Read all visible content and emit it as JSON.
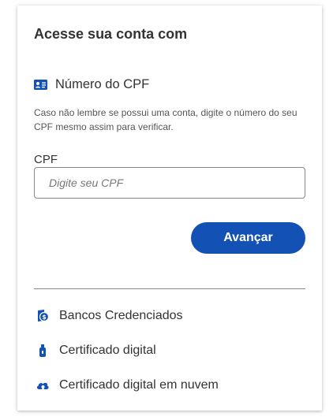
{
  "card": {
    "title": "Acesse sua conta com"
  },
  "cpf_section": {
    "icon": "id-card-icon",
    "heading": "Número do CPF",
    "hint": "Caso não lembre se possui uma conta, digite o número do seu CPF mesmo assim para verificar.",
    "field_label": "CPF",
    "input_value": "",
    "input_placeholder": "Digite seu CPF",
    "submit_label": "Avançar"
  },
  "other_options": [
    {
      "icon": "bank-icon",
      "label": "Bancos Credenciados"
    },
    {
      "icon": "usb-token-icon",
      "label": "Certificado digital"
    },
    {
      "icon": "cloud-certificate-icon",
      "label": "Certificado digital em nuvem"
    }
  ],
  "colors": {
    "primary": "#1351b4",
    "text": "#333333",
    "border": "#888888"
  }
}
